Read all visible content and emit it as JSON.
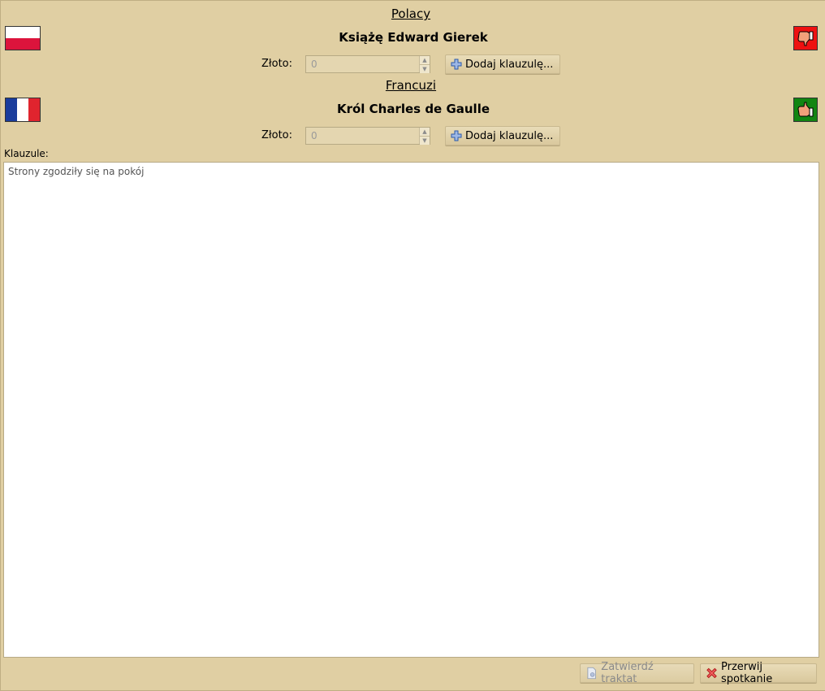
{
  "parties": [
    {
      "nation": "Polacy",
      "leader": "Książę Edward Gierek",
      "gold_label": "Złoto:",
      "gold_value": "0",
      "add_clause_label": "Dodaj klauzulę...",
      "flag_colors": [
        "#ffffff",
        "#dc143c"
      ],
      "status_icon": "thumbs-down-icon",
      "status_color": "#ee1111"
    },
    {
      "nation": "Francuzi",
      "leader": "Król Charles de Gaulle",
      "gold_label": "Złoto:",
      "gold_value": "0",
      "add_clause_label": "Dodaj klauzulę...",
      "flag_colors": [
        "#1a3c9c",
        "#ffffff",
        "#e0242e"
      ],
      "status_icon": "thumbs-up-icon",
      "status_color": "#128512"
    }
  ],
  "clauses": {
    "label": "Klauzule:",
    "items": [
      "Strony zgodziły się na pokój"
    ]
  },
  "footer": {
    "accept_label": "Zatwierdź traktat",
    "cancel_label": "Przerwij spotkanie"
  }
}
